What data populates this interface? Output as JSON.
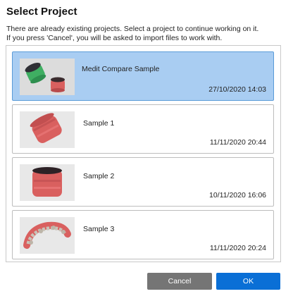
{
  "dialog": {
    "title": "Select Project",
    "description_line1": "There are already existing projects. Select a project to continue working on it.",
    "description_line2": "If you press 'Cancel', you will be asked to import files to work with."
  },
  "projects": [
    {
      "name": "Medit Compare Sample",
      "date": "27/10/2020 14:03",
      "selected": true,
      "thumbnail": "two-dental-scans-thumbnail"
    },
    {
      "name": "Sample 1",
      "date": "11/11/2020 20:44",
      "selected": false,
      "thumbnail": "tooth-scan-thumbnail"
    },
    {
      "name": "Sample 2",
      "date": "10/11/2020 16:06",
      "selected": false,
      "thumbnail": "tooth-scan-thumbnail"
    },
    {
      "name": "Sample 3",
      "date": "11/11/2020 20:24",
      "selected": false,
      "thumbnail": "dental-arch-scan-thumbnail"
    }
  ],
  "buttons": {
    "cancel_label": "Cancel",
    "ok_label": "OK"
  },
  "colors": {
    "selected_bg": "#a9cdf2",
    "selected_border": "#5a9bd8",
    "cancel_bg": "#757575",
    "ok_bg": "#0a6fd6",
    "scan_pink": "#d9605f",
    "scan_green": "#3fae62"
  }
}
